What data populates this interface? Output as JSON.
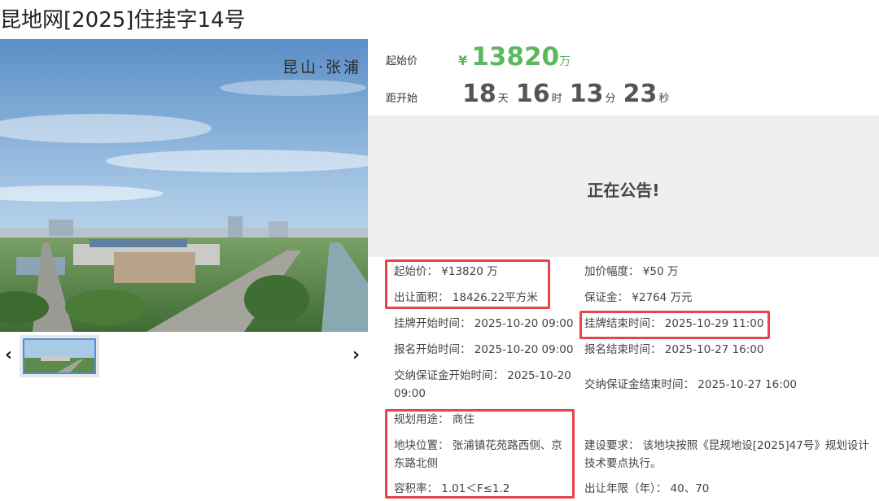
{
  "page": {
    "title": "昆地网[2025]住挂字14号"
  },
  "gallery": {
    "caption": "昆山·张浦",
    "prev_icon": "chevron-left-icon",
    "next_icon": "chevron-right-icon",
    "prev_glyph": "‹",
    "next_glyph": "›"
  },
  "price": {
    "label": "起始价",
    "currency": "¥",
    "value": "13820",
    "unit": "万"
  },
  "countdown": {
    "label": "距开始",
    "days": "18",
    "days_unit": "天",
    "hours": "16",
    "hours_unit": "时",
    "minutes": "13",
    "minutes_unit": "分",
    "seconds": "23",
    "seconds_unit": "秒"
  },
  "notice": {
    "text": "正在公告!"
  },
  "details": {
    "start_price": "起始价： ¥13820 万",
    "increment": "加价幅度： ¥50 万",
    "area": "出让面积： 18426.22平方米",
    "deposit": "保证金： ¥2764 万元",
    "list_start": "挂牌开始时间： 2025-10-20 09:00",
    "list_end": "挂牌结束时间： 2025-10-29 11:00",
    "reg_start": "报名开始时间： 2025-10-20 09:00",
    "reg_end": "报名结束时间： 2025-10-27 16:00",
    "pay_start_line1": "交纳保证金开始时间： 2025-10-20",
    "pay_start_line2": "09:00",
    "pay_end": "交纳保证金结束时间： 2025-10-27 16:00",
    "usage": "规划用途： 商住",
    "location_line1": "地块位置： 张浦镇花苑路西侧、京",
    "location_line2": "东路北侧",
    "build_req_line1": "建设要求： 该地块按照《昆规地设[2025]47号》规划设计",
    "build_req_line2": "技术要点执行。",
    "far": "容积率： 1.01＜F≤1.2",
    "term": "出让年限（年）： 40、70"
  },
  "colors": {
    "price_green": "#5cb85c",
    "highlight_red": "#e8424a",
    "notice_bg": "#efefef"
  }
}
